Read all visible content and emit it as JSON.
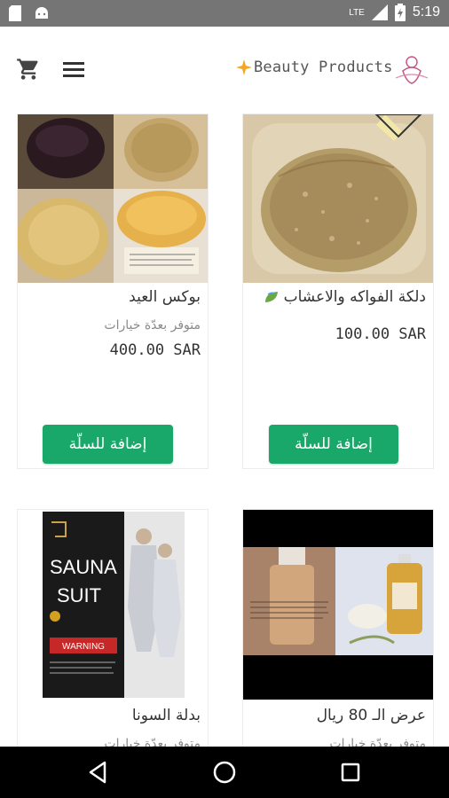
{
  "status_bar": {
    "time": "5:19",
    "network": "LTE",
    "icons": [
      "sd-card-icon",
      "android-icon",
      "signal-icon",
      "battery-icon"
    ]
  },
  "app_bar": {
    "brand_name": "Beauty Products",
    "icons": [
      "cart-icon",
      "menu-icon",
      "sparkle-icon",
      "brand-logo"
    ]
  },
  "products": [
    {
      "title": "دلكة الفواكه والاعشاب",
      "subtitle": "",
      "price": "100.00 SAR",
      "button_label": "إضافة للسلّة"
    },
    {
      "title": "بوكس العيد",
      "subtitle": "متوفر بعدّة خيارات",
      "price": "400.00 SAR",
      "button_label": "إضافة للسلّة"
    },
    {
      "title": "عرض الـ 80 ريال",
      "subtitle": "متوفر بعدّة خيارات",
      "price": "",
      "button_label": ""
    },
    {
      "title": "بدلة السونا",
      "subtitle": "متوفر بعدّة خيارات",
      "price": "",
      "button_label": ""
    }
  ],
  "sauna_image_text": {
    "line1": "SAUNA",
    "line2": "SUIT",
    "warning": "WARNING"
  },
  "colors": {
    "status_bar": "#757575",
    "accent_button": "#1aa86a",
    "nav_bar": "#000000",
    "brand_sparkle": "#f5a623",
    "logo_pink": "#c45a8a"
  }
}
